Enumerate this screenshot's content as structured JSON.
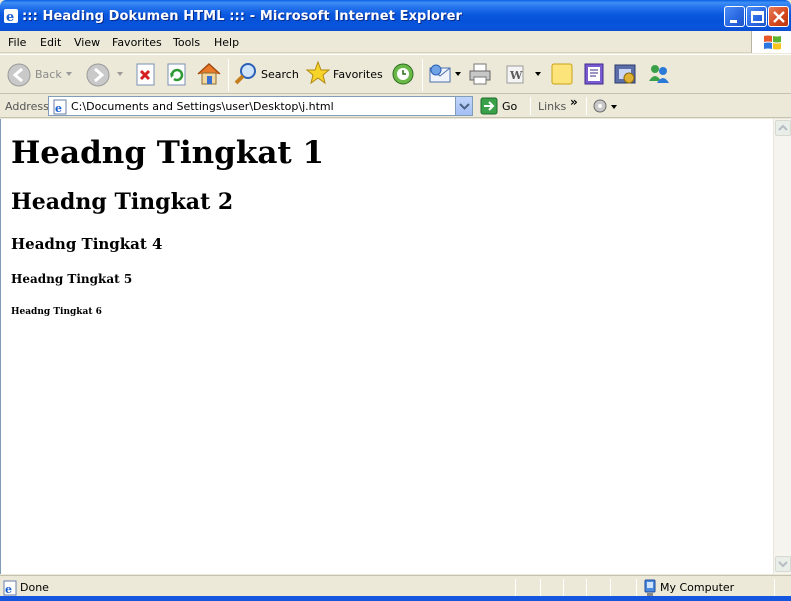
{
  "window": {
    "title": "::: Heading Dokumen HTML ::: - Microsoft Internet Explorer"
  },
  "menu": {
    "items": [
      "File",
      "Edit",
      "View",
      "Favorites",
      "Tools",
      "Help"
    ]
  },
  "toolbar": {
    "back_label": "Back",
    "search_label": "Search",
    "favorites_label": "Favorites"
  },
  "address": {
    "label": "Address",
    "url": "C:\\Documents and Settings\\user\\Desktop\\j.html",
    "go_label": "Go",
    "links_label": "Links",
    "chevron": "»"
  },
  "content": {
    "h1": "Headng Tingkat 1",
    "h2": "Headng Tingkat 2",
    "h4": "Headng Tingkat 4",
    "h5": "Headng Tingkat 5",
    "h6": "Headng Tingkat 6"
  },
  "status": {
    "text": "Done",
    "zone": "My Computer"
  },
  "colors": {
    "titlebar": "#0b5ae0",
    "chrome": "#ece9d8",
    "content_bg": "#ffffff"
  }
}
